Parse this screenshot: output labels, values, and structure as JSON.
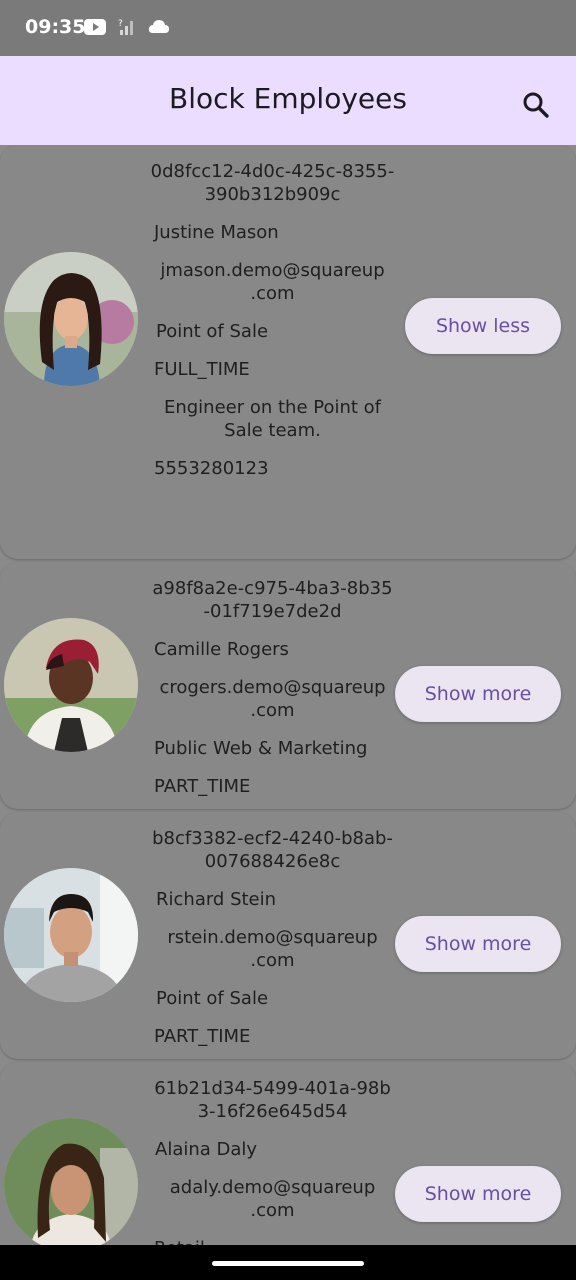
{
  "status": {
    "time": "09:35"
  },
  "header": {
    "title": "Block Employees"
  },
  "employees": [
    {
      "id_line1": "0d8fcc12-4d0c-425c-8355-",
      "id_line2": "390b312b909c",
      "name": "Justine Mason",
      "email_line1": "jmason.demo@squareup",
      "email_line2": ".com",
      "team": "Point of Sale",
      "type": "FULL_TIME",
      "bio_line1": "Engineer on the Point of",
      "bio_line2": "Sale team.",
      "phone": "5553280123",
      "button": "Show less"
    },
    {
      "id_line1": "a98f8a2e-c975-4ba3-8b35",
      "id_line2": "-01f719e7de2d",
      "name": "Camille Rogers",
      "email_line1": "crogers.demo@squareup",
      "email_line2": ".com",
      "team": "Public Web & Marketing",
      "type": "PART_TIME",
      "button": "Show more"
    },
    {
      "id_line1": "b8cf3382-ecf2-4240-b8ab-",
      "id_line2": "007688426e8c",
      "name": "Richard Stein",
      "email_line1": "rstein.demo@squareup",
      "email_line2": ".com",
      "team": "Point of Sale",
      "type": "PART_TIME",
      "button": "Show more"
    },
    {
      "id_line1": "61b21d34-5499-401a-98b",
      "id_line2": "3-16f26e645d54",
      "name": "Alaina Daly",
      "email_line1": "adaly.demo@squareup",
      "email_line2": ".com",
      "team": "Retail",
      "button": "Show more"
    }
  ]
}
